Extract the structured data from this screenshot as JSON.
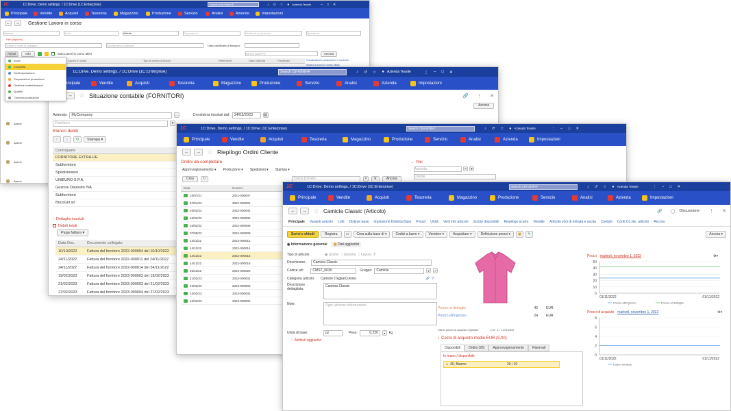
{
  "w1": {
    "title": "1C:Drive. Demo settings. / 1C:Drive (1C:Enterprise)",
    "search": "Search Ctrl+Shift+F",
    "user": "Azienda Tessile",
    "sections": [
      "Principale",
      "Vendite",
      "Acquisti",
      "Tesoreria",
      "Magazzino",
      "Produzione",
      "Servizio",
      "Analisi",
      "Azienda",
      "Impostazioni"
    ],
    "heading": "Gestione Lavoro in corso",
    "f1": [
      "Reparto",
      "Sede",
      "Attività",
      "Operazione",
      "Ordine di produzione",
      "Operatore"
    ],
    "f1b": [
      "Ordine in stato di dettaglio",
      "Giustificativo collegato",
      "Data pianificata di bisogno:"
    ],
    "filters_label": "Filtri (diplano)",
    "toolbar": {
      "actions": "Azioni",
      "info": "Info",
      "checkbox": "Solo Lavori in corso attivi",
      "search": "Cerca (Ctrl+F)",
      "more": "Ancora"
    },
    "menu": [
      "Avvia",
      "Completa",
      "Dividi operazione",
      "Preparazione produzione",
      "Gestione materiale/prod.",
      "Qualità",
      "Controllo produzione"
    ],
    "grid_cols": [
      "Lavoro in corso",
      "Tipo di centro di lavoro",
      "Riferimenti",
      "Data ordinata",
      "Pianificato"
    ],
    "side_links": [
      "Pianificazione produzione e controllo",
      "Mostra Lavoro in corso citato"
    ],
    "rows": [
      "Aperto",
      "Aperto",
      "Aperto",
      "Aperto"
    ]
  },
  "w2": {
    "title": "1C:Drive. Demo settings. / 1C:Drive (1C:Enterprise)",
    "search": "Search Ctrl+Shift+F",
    "user": "Azienda Tessile",
    "sections": [
      "Principale",
      "Vendite",
      "Acquisti",
      "Tesoreria",
      "Magazzino",
      "Produzione",
      "Servizio",
      "Analisi",
      "Azienda",
      "Impostazioni"
    ],
    "heading": "Situazione contabile (FORNITORI)",
    "more": "Ancora",
    "company_label": "Azienda:",
    "company_value": "MyCompany",
    "consider_label": "Considera insoluti dal:",
    "consider_value": "14/03/2023",
    "fornitore_ph": "Fornitore",
    "debts_title": "Elenco debiti",
    "print": "Stampa",
    "col_counterpart": "Controparte",
    "suppliers": [
      "FORNITORE EXTRA-UE",
      "Subfornitore",
      "Spedizioniere",
      "UNIEURO S.P.A.",
      "Gestore Deposito IVA",
      "Subfornitore",
      "BricoGirl srl"
    ],
    "detail_label": "Dettaglio insoluti",
    "total_label": "Debiti totali",
    "pay_btn": "Paga fattura",
    "doc_cols": [
      "Data Doc.",
      "Documento collegato"
    ],
    "docs": [
      {
        "d": "10/10/2022",
        "t": "Fattura del fornitore 2022-000004 del 10/10/2022"
      },
      {
        "d": "24/11/2022",
        "t": "Fattura del fornitore 2022-000011 del 24/11/2022"
      },
      {
        "d": "24/11/2022",
        "t": "Fattura del fornitore 2022-000014 del 24/11/2022"
      },
      {
        "d": "19/02/2023",
        "t": "Fattura del fornitore 2023-000002 del 19/02/2023"
      },
      {
        "d": "21/02/2023",
        "t": "Fattura del fornitore 2023-000003 del 21/02/2023"
      },
      {
        "d": "27/02/2023",
        "t": "Fattura del fornitore 2023-000004 del 27/02/2023"
      }
    ]
  },
  "w3": {
    "title": "1C:Drive. Demo settings. / 1C:Drive (1C:Enterprise)",
    "search": "Search Ctrl+Shift+F",
    "user": "Azienda Tessile",
    "sections": [
      "Principale",
      "Vendite",
      "Acquisti",
      "Tesoreria",
      "Magazzino",
      "Produzione",
      "Servizio",
      "Analisi",
      "Azienda",
      "Impostazioni"
    ],
    "heading": "Riepilogo Ordini Cliente",
    "to_complete": "Ordini da completare",
    "tabs": [
      "Approvvigionamento",
      "Produzione",
      "Spedizioni",
      "Stampa"
    ],
    "create": "Crea",
    "search_ph": "Cerca (Ctrl+F)",
    "more": "Ancora",
    "filter": "Filtri",
    "filter_fields": [
      "Azienda",
      "Cliente"
    ],
    "cols": [
      "Data",
      "Numero"
    ],
    "orders": [
      {
        "d": "15/07/21",
        "n": "2021-000007"
      },
      {
        "d": "27/01/22",
        "n": "2022-000001"
      },
      {
        "d": "16/02/22",
        "n": "2022-000004"
      },
      {
        "d": "16/02/22",
        "n": "2022-000005"
      },
      {
        "d": "16/02/22",
        "n": "2022-000006"
      },
      {
        "d": "07/09/22",
        "n": "2022-000009"
      },
      {
        "d": "14/11/22",
        "n": "2022-000012"
      },
      {
        "d": "14/11/22",
        "n": "2022-000014"
      },
      {
        "d": "14/11/22",
        "n": "2022-000016"
      },
      {
        "d": "14/11/22",
        "n": "2022-000016"
      },
      {
        "d": "15/11/22",
        "n": "2022-000020"
      },
      {
        "d": "21/02/23",
        "n": "2023-000001"
      },
      {
        "d": "13/03/23",
        "n": "2023-000003"
      },
      {
        "d": "13/03/23",
        "n": "2023-000004"
      },
      {
        "d": "13/03/23",
        "n": "2023-000002"
      }
    ]
  },
  "w4": {
    "title": "1C:Drive. Demo settings. / 1C:Drive (1C:Enterprise)",
    "search": "Search Ctrl+Shift+F",
    "user": "Azienda Tessile",
    "sections": [
      "Principale",
      "Vendite",
      "Acquisti",
      "Tesoreria",
      "Magazzino",
      "Produzione",
      "Servizio",
      "Analisi",
      "Azienda",
      "Impostazioni"
    ],
    "heading": "Camicia Classic (Articolo)",
    "discussion": "Discussione",
    "tabs": [
      "Principale",
      "Varianti articolo",
      "Lotti",
      "Distinte base",
      "Implosione Distinta Base",
      "Prezzi",
      "Unità",
      "Vedi info articolo",
      "Scorte disponibili",
      "Riepilogo scorte",
      "Vendite",
      "Articolo voci di entrata e uscita",
      "Compiti",
      "Conti Co.Ge. articolo",
      "Ancora"
    ],
    "toolbar": {
      "save_close": "Scrivi e chiudi",
      "save": "Registra",
      "create_base": "Crea sulla base di",
      "barcode": "Codici a barre",
      "sell": "Vendere",
      "buy": "Acquistare",
      "define_prices": "Definizione prezzi",
      "more": "Ancora"
    },
    "subtabs": [
      "Informazione generale",
      "Dati aggiuntivi"
    ],
    "type_label": "Tipo di articolo:",
    "types": [
      "Scorte",
      "Servizio",
      "Lavoro"
    ],
    "desc_label": "Descrizione:",
    "desc_value": "Camicia Classic",
    "code_label": "Codice art:",
    "code_value": "CMST_0030",
    "group_label": "Gruppo:",
    "group_value": "Camicie",
    "cat_label": "Categoria articolo:",
    "cat_value": "Camicie (Taglia/Colore)",
    "detdesc_label": "Descrizione dettagliata:",
    "detdesc_value": "Camicia Classic",
    "note_label": "Note:",
    "note_ph": "Ogni ulteriore informazione",
    "unit_label": "Unità di base:",
    "unit_value": "pz",
    "weight_label": "Peso:",
    "weight_value": "0,220",
    "weight_unit": "kg",
    "more_attr": "Attributi aggiuntivi",
    "retail_label": "Prezzo al dettaglio",
    "retail_value": "42",
    "retail_cur": "EUR",
    "wholesale_label": "Prezzo all'ingrosso",
    "wholesale_value": "24",
    "wholesale_cur": "EUR",
    "last_purchase_label": "Ultimo prezzo di acquisto registrato",
    "last_purchase_value": "2,00",
    "last_purchase_on": "in",
    "last_purchase_date": "14/11/2022",
    "avg_cost": "Costo di acquisto medio EUR (5,00)",
    "stock_tabs": [
      "Disponibili",
      "Ordini (26)",
      "Approvvigionamento",
      "Riservati"
    ],
    "in_hand": "In mano / disponibile",
    "stock_item": "40, Bianco",
    "stock_qty": "20 / 20",
    "prices_title": "Prezzi",
    "prices_date": "martedì, novembre 1, 2022",
    "purchase_title": "Prezzi di acquisto",
    "purchase_date": "martedì, novembre 1, 2022"
  },
  "chart_data": [
    {
      "type": "line",
      "title": "Prezzi",
      "subtitle": "martedì, novembre 1, 2022",
      "x": [
        "01/11/2022",
        "01/11/2022"
      ],
      "series": [
        {
          "name": "Prezzo all'ingrosso",
          "values": [
            24,
            24
          ]
        },
        {
          "name": "Prezzo al dettaglio",
          "values": [
            42,
            42
          ]
        }
      ],
      "yticks": [
        0,
        10,
        20,
        30,
        40,
        50
      ],
      "ylim": [
        0,
        50
      ],
      "legend": "bottom",
      "colors": [
        "#7db5e8",
        "#8fd39a"
      ]
    },
    {
      "type": "line",
      "title": "Prezzi di acquisto",
      "subtitle": "martedì, novembre 1, 2022",
      "x": [
        "01/11/2022",
        "01/11/2022"
      ],
      "series": [
        {
          "name": "Listino fornitore",
          "values": [
            2,
            2
          ]
        }
      ],
      "yticks": [
        0,
        2,
        4,
        6,
        8
      ],
      "ylim": [
        0,
        8
      ],
      "legend": "bottom",
      "colors": [
        "#7db5e8"
      ]
    }
  ]
}
